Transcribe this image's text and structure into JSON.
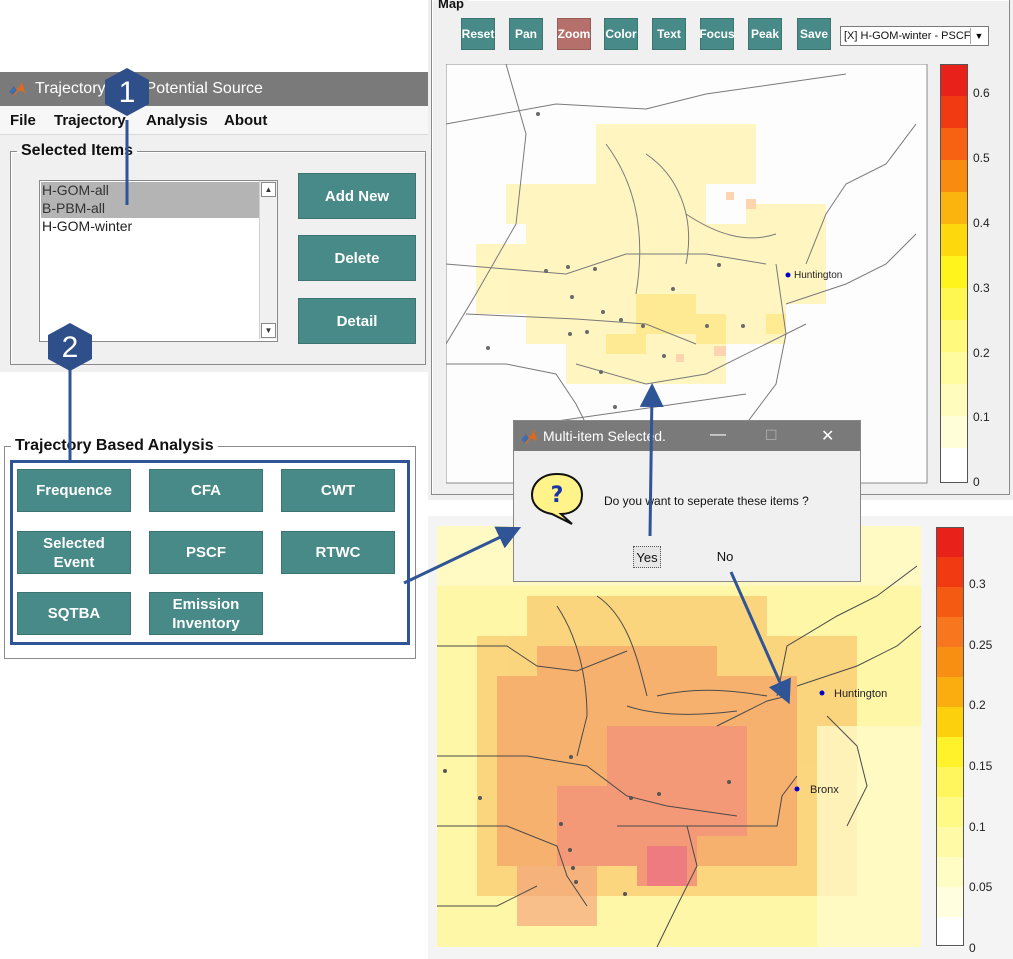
{
  "main_window": {
    "title": "Trajectory",
    "title_suffix": "l Potential Source",
    "menu": [
      "File",
      "Trajectory",
      "Analysis",
      "About"
    ],
    "selected_items": {
      "legend": "Selected Items",
      "items": [
        "H-GOM-all",
        "B-PBM-all",
        "H-GOM-winter"
      ],
      "selected_count": 2
    },
    "buttons": [
      "Add New",
      "Delete",
      "Detail"
    ],
    "analysis": {
      "legend": "Trajectory Based Analysis",
      "buttons": [
        [
          "Frequence",
          "CFA",
          "CWT"
        ],
        [
          "Selected\nEvent",
          "PSCF",
          "RTWC"
        ],
        [
          "SQTBA",
          "Emission\nInventory"
        ]
      ]
    }
  },
  "annotations": {
    "badge_1": "1",
    "badge_2": "2",
    "arrow_color": "#2f5597"
  },
  "top_map": {
    "legend": "Map",
    "toolbar": [
      "Reset",
      "Pan",
      "Zoom",
      "Color",
      "Text",
      "Focus",
      "Peak",
      "Save"
    ],
    "active_tool": "Zoom",
    "dropdown_value": "[X] H-GOM-winter - PSCF",
    "site_label": "Huntington",
    "colorbar_ticks": [
      "0.6",
      "0.5",
      "0.4",
      "0.3",
      "0.2",
      "0.1",
      "0"
    ]
  },
  "bottom_map": {
    "site_labels": [
      "Huntington",
      "Bronx"
    ],
    "colorbar_ticks": [
      "0.3",
      "0.25",
      "0.2",
      "0.15",
      "0.1",
      "0.05",
      "0"
    ]
  },
  "dialog": {
    "title": "Multi-item Selected.",
    "icon_glyph": "?",
    "message": "Do you want to seperate these items ?",
    "yes_label": "Yes",
    "no_label": "No",
    "controls": [
      "—",
      "☐",
      "✕"
    ]
  },
  "colors": {
    "teal_button": "#478a87",
    "zoom_active": "#b5706b",
    "titlebar": "#7a7a7a",
    "badge": "#2f4f8a"
  }
}
